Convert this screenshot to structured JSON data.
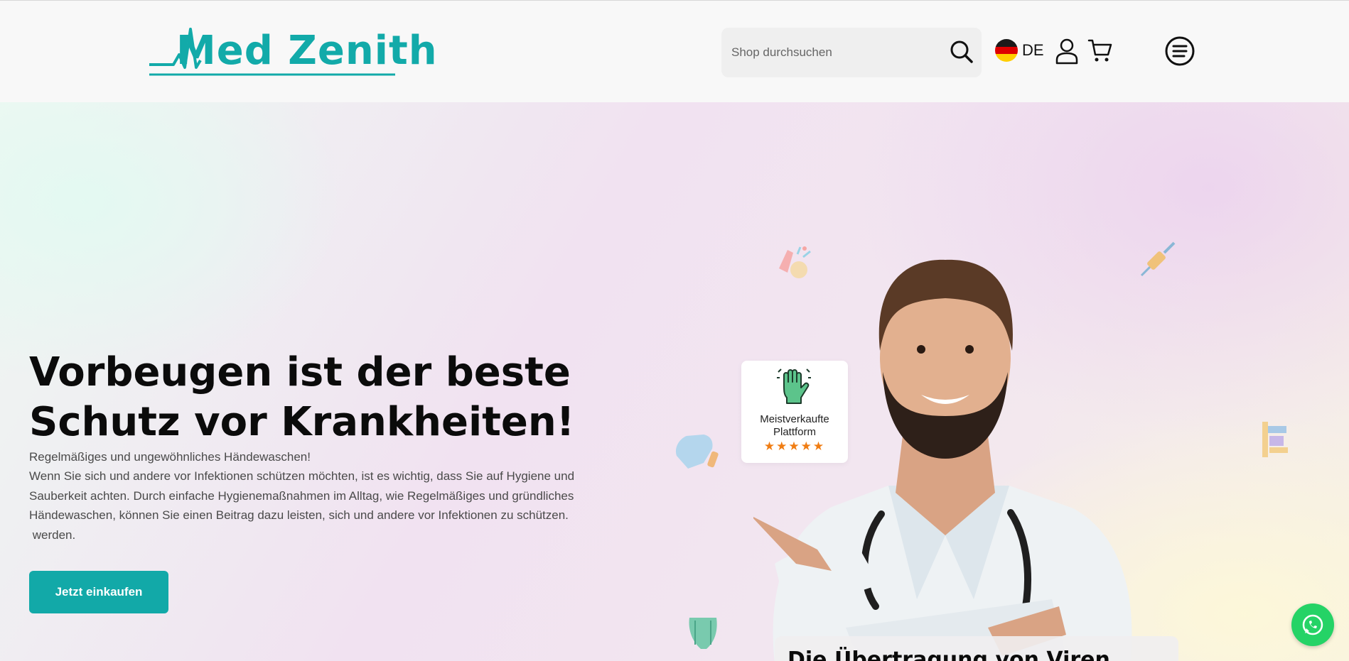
{
  "header": {
    "logo_text": "Med Zenith",
    "search": {
      "placeholder": "Shop durchsuchen"
    },
    "language": {
      "code": "DE",
      "flag": "germany-flag"
    },
    "icons": [
      "search-icon",
      "user-icon",
      "cart-icon",
      "menu-icon"
    ]
  },
  "hero": {
    "headline_line1": "Vorbeugen ist der beste",
    "headline_line2": "Schutz vor Krankheiten!",
    "subline": "Regelmäßiges und ungewöhnliches Händewaschen!",
    "paragraph_lines": [
      "Wenn Sie sich und andere vor Infektionen schützen möchten, ist es wichtig, dass Sie auf Hygiene und",
      "Sauberkeit achten. Durch einfache Hygienemaßnahmen im Alltag, wie Regelmäßiges und gründliches",
      "Händewaschen, können Sie einen Beitrag dazu leisten, sich und andere vor Infektionen zu schützen.",
      " werden."
    ],
    "cta_label": "Jetzt einkaufen",
    "badge": {
      "line1": "Meistverkaufte",
      "line2": "Plattform",
      "stars": "★★★★★",
      "rating": 5
    },
    "card_title": "Die Übertragung von Viren"
  },
  "colors": {
    "brand": "#12aaa9",
    "cta": "#12a9a8",
    "star": "#f07d13",
    "whatsapp": "#25d366"
  }
}
